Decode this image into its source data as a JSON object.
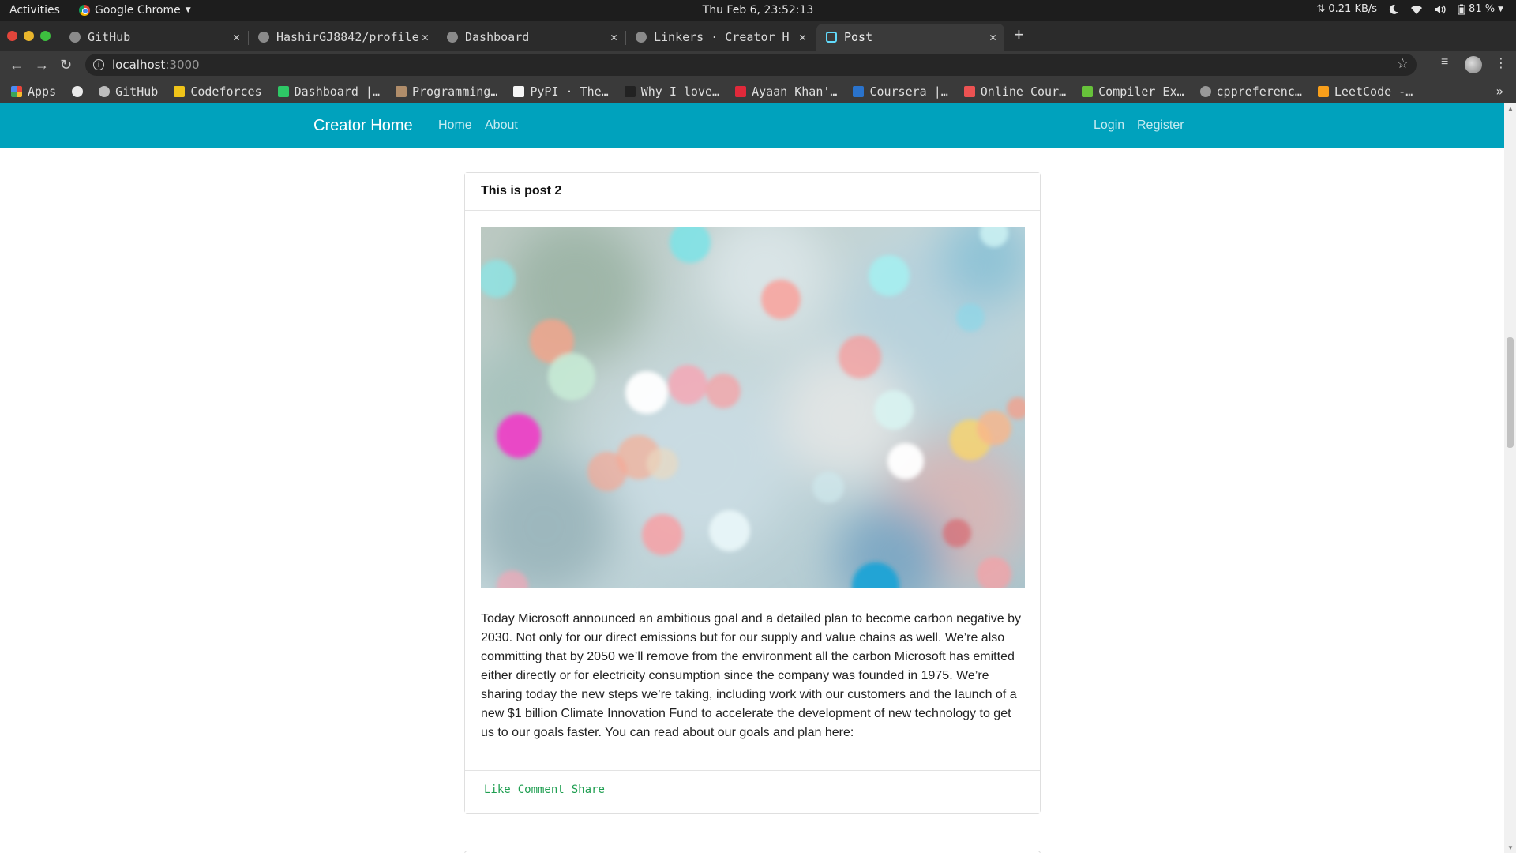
{
  "os": {
    "activities": "Activities",
    "app_name": "Google Chrome",
    "clock": "Thu Feb  6, 23:52:13",
    "network_speed": "⇅ 0.21 KB/s",
    "battery": "81 %"
  },
  "tabs": [
    {
      "title": "GitHub",
      "active": false
    },
    {
      "title": "HashirGJ8842/profile",
      "active": false
    },
    {
      "title": "Dashboard",
      "active": false
    },
    {
      "title": "Linkers · Creator H",
      "active": false
    },
    {
      "title": "Post",
      "active": true
    }
  ],
  "address_bar": {
    "host": "localhost",
    "port": ":3000"
  },
  "bookmarks": [
    {
      "label": "Apps",
      "icon": "apps-grid-icon",
      "color": "#e8453c"
    },
    {
      "label": "",
      "icon": "globe-icon",
      "color": "#eaeaea"
    },
    {
      "label": "GitHub",
      "icon": "github-icon",
      "color": "#bdbdbd"
    },
    {
      "label": "Codeforces",
      "icon": "codeforces-icon",
      "color": "#f0c419"
    },
    {
      "label": "Dashboard |…",
      "icon": "hackerrank-icon",
      "color": "#2ec866"
    },
    {
      "label": "Programming…",
      "icon": "codechef-icon",
      "color": "#b08d6a"
    },
    {
      "label": "PyPI · The…",
      "icon": "pypi-icon",
      "color": "#f5f5f5"
    },
    {
      "label": "Why I love…",
      "icon": "analytics-icon",
      "color": "#222222"
    },
    {
      "label": "Ayaan Khan'…",
      "icon": "medium-icon",
      "color": "#e0293a"
    },
    {
      "label": "Coursera |…",
      "icon": "coursera-icon",
      "color": "#2a73cc"
    },
    {
      "label": "Online Cour…",
      "icon": "udemy-icon",
      "color": "#ec5252"
    },
    {
      "label": "Compiler Ex…",
      "icon": "compiler-icon",
      "color": "#67c23a"
    },
    {
      "label": "cppreferenc…",
      "icon": "cppreference-icon",
      "color": "#999999"
    },
    {
      "label": "LeetCode -…",
      "icon": "leetcode-icon",
      "color": "#f89f1b"
    }
  ],
  "site_nav": {
    "brand": "Creator Home",
    "links": [
      "Home",
      "About"
    ],
    "auth_links": [
      "Login",
      "Register"
    ],
    "bg_color": "#00a2bd"
  },
  "post": {
    "title": "This is post 2",
    "image_icon": "bokeh-photo",
    "body": "Today Microsoft announced an ambitious goal and a detailed plan to become carbon negative by 2030. Not only for our direct emissions but for our supply and value chains as well. We’re also committing that by 2050 we’ll remove from the environment all the carbon Microsoft has emitted either directly or for electricity consumption since the company was founded in 1975. We’re sharing today the new steps we’re taking, including work with our customers and the launch of a new $1 billion Climate Innovation Fund to accelerate the development of new technology to get us to our goals faster. You can read about our goals and plan here:",
    "actions": [
      "Like",
      "Comment",
      "Share"
    ],
    "action_color": "#1e9e50"
  }
}
